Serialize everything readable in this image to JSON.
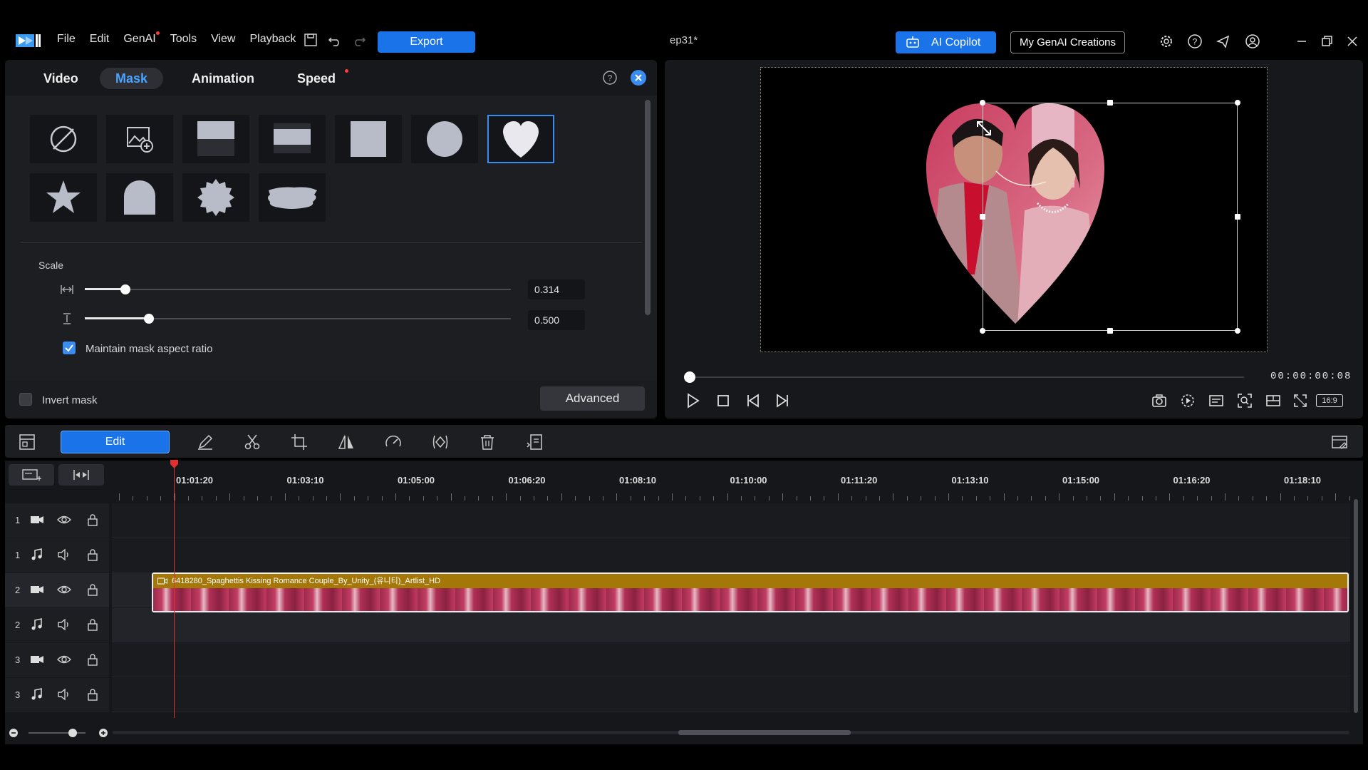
{
  "app": {
    "menu": [
      "File",
      "Edit",
      "GenAI",
      "Tools",
      "View",
      "Playback"
    ],
    "export_label": "Export",
    "document_title": "ep31*",
    "copilot_label": "AI Copilot",
    "genai_creations_label": "My GenAI Creations"
  },
  "panel": {
    "tabs": [
      "Video",
      "Mask",
      "Animation",
      "Speed"
    ],
    "active_tab": "Mask",
    "mask_shapes": [
      "none-icon",
      "image-mask-icon",
      "half-top-icon",
      "band-icon",
      "square-icon",
      "circle-icon",
      "heart-icon",
      "star-icon",
      "arch-icon",
      "badge-icon",
      "brush-stroke-icon"
    ],
    "selected_shape": "heart-icon",
    "scale_label": "Scale",
    "width_value": "0.314",
    "height_value": "0.500",
    "width_fraction": 0.314,
    "height_fraction": 0.5,
    "maintain_label": "Maintain mask aspect ratio",
    "maintain_checked": true,
    "invert_label": "Invert mask",
    "invert_checked": false,
    "advanced_label": "Advanced"
  },
  "preview": {
    "timecode": "00:00:00:08",
    "aspect_label": "16:9",
    "progress": 0.0
  },
  "toolbar": {
    "edit_label": "Edit"
  },
  "timeline": {
    "ruler_labels": [
      "01:01:20",
      "01:03:10",
      "01:05:00",
      "01:06:20",
      "01:08:10",
      "01:10:00",
      "01:11:20",
      "01:13:10",
      "01:15:00",
      "01:16:20",
      "01:18:10"
    ],
    "tracks": [
      {
        "num": "1",
        "type": "video"
      },
      {
        "num": "1",
        "type": "audio"
      },
      {
        "num": "2",
        "type": "video"
      },
      {
        "num": "2",
        "type": "audio"
      },
      {
        "num": "3",
        "type": "video"
      },
      {
        "num": "3",
        "type": "audio"
      }
    ],
    "clip_name": "6418280_Spaghettis Kissing Romance Couple_By_Unity_(유니티)_Artlist_HD"
  },
  "colors": {
    "accent": "#1a73e8",
    "clip_title": "#a47808",
    "playhead": "#e03030"
  }
}
